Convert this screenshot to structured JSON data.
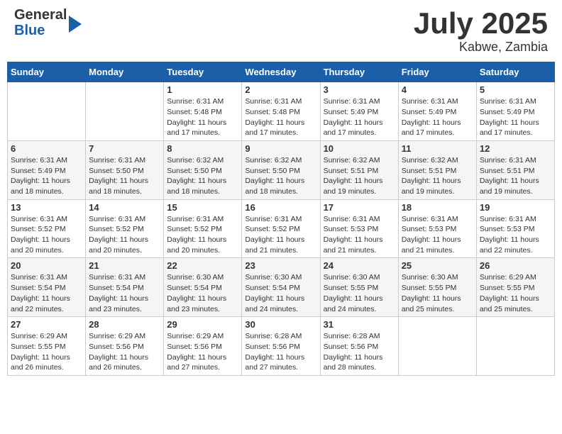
{
  "header": {
    "logo_general": "General",
    "logo_blue": "Blue",
    "month_title": "July 2025",
    "location": "Kabwe, Zambia"
  },
  "calendar": {
    "days_of_week": [
      "Sunday",
      "Monday",
      "Tuesday",
      "Wednesday",
      "Thursday",
      "Friday",
      "Saturday"
    ],
    "weeks": [
      [
        {
          "day": "",
          "info": ""
        },
        {
          "day": "",
          "info": ""
        },
        {
          "day": "1",
          "info": "Sunrise: 6:31 AM\nSunset: 5:48 PM\nDaylight: 11 hours and 17 minutes."
        },
        {
          "day": "2",
          "info": "Sunrise: 6:31 AM\nSunset: 5:48 PM\nDaylight: 11 hours and 17 minutes."
        },
        {
          "day": "3",
          "info": "Sunrise: 6:31 AM\nSunset: 5:49 PM\nDaylight: 11 hours and 17 minutes."
        },
        {
          "day": "4",
          "info": "Sunrise: 6:31 AM\nSunset: 5:49 PM\nDaylight: 11 hours and 17 minutes."
        },
        {
          "day": "5",
          "info": "Sunrise: 6:31 AM\nSunset: 5:49 PM\nDaylight: 11 hours and 17 minutes."
        }
      ],
      [
        {
          "day": "6",
          "info": "Sunrise: 6:31 AM\nSunset: 5:49 PM\nDaylight: 11 hours and 18 minutes."
        },
        {
          "day": "7",
          "info": "Sunrise: 6:31 AM\nSunset: 5:50 PM\nDaylight: 11 hours and 18 minutes."
        },
        {
          "day": "8",
          "info": "Sunrise: 6:32 AM\nSunset: 5:50 PM\nDaylight: 11 hours and 18 minutes."
        },
        {
          "day": "9",
          "info": "Sunrise: 6:32 AM\nSunset: 5:50 PM\nDaylight: 11 hours and 18 minutes."
        },
        {
          "day": "10",
          "info": "Sunrise: 6:32 AM\nSunset: 5:51 PM\nDaylight: 11 hours and 19 minutes."
        },
        {
          "day": "11",
          "info": "Sunrise: 6:32 AM\nSunset: 5:51 PM\nDaylight: 11 hours and 19 minutes."
        },
        {
          "day": "12",
          "info": "Sunrise: 6:31 AM\nSunset: 5:51 PM\nDaylight: 11 hours and 19 minutes."
        }
      ],
      [
        {
          "day": "13",
          "info": "Sunrise: 6:31 AM\nSunset: 5:52 PM\nDaylight: 11 hours and 20 minutes."
        },
        {
          "day": "14",
          "info": "Sunrise: 6:31 AM\nSunset: 5:52 PM\nDaylight: 11 hours and 20 minutes."
        },
        {
          "day": "15",
          "info": "Sunrise: 6:31 AM\nSunset: 5:52 PM\nDaylight: 11 hours and 20 minutes."
        },
        {
          "day": "16",
          "info": "Sunrise: 6:31 AM\nSunset: 5:52 PM\nDaylight: 11 hours and 21 minutes."
        },
        {
          "day": "17",
          "info": "Sunrise: 6:31 AM\nSunset: 5:53 PM\nDaylight: 11 hours and 21 minutes."
        },
        {
          "day": "18",
          "info": "Sunrise: 6:31 AM\nSunset: 5:53 PM\nDaylight: 11 hours and 21 minutes."
        },
        {
          "day": "19",
          "info": "Sunrise: 6:31 AM\nSunset: 5:53 PM\nDaylight: 11 hours and 22 minutes."
        }
      ],
      [
        {
          "day": "20",
          "info": "Sunrise: 6:31 AM\nSunset: 5:54 PM\nDaylight: 11 hours and 22 minutes."
        },
        {
          "day": "21",
          "info": "Sunrise: 6:31 AM\nSunset: 5:54 PM\nDaylight: 11 hours and 23 minutes."
        },
        {
          "day": "22",
          "info": "Sunrise: 6:30 AM\nSunset: 5:54 PM\nDaylight: 11 hours and 23 minutes."
        },
        {
          "day": "23",
          "info": "Sunrise: 6:30 AM\nSunset: 5:54 PM\nDaylight: 11 hours and 24 minutes."
        },
        {
          "day": "24",
          "info": "Sunrise: 6:30 AM\nSunset: 5:55 PM\nDaylight: 11 hours and 24 minutes."
        },
        {
          "day": "25",
          "info": "Sunrise: 6:30 AM\nSunset: 5:55 PM\nDaylight: 11 hours and 25 minutes."
        },
        {
          "day": "26",
          "info": "Sunrise: 6:29 AM\nSunset: 5:55 PM\nDaylight: 11 hours and 25 minutes."
        }
      ],
      [
        {
          "day": "27",
          "info": "Sunrise: 6:29 AM\nSunset: 5:55 PM\nDaylight: 11 hours and 26 minutes."
        },
        {
          "day": "28",
          "info": "Sunrise: 6:29 AM\nSunset: 5:56 PM\nDaylight: 11 hours and 26 minutes."
        },
        {
          "day": "29",
          "info": "Sunrise: 6:29 AM\nSunset: 5:56 PM\nDaylight: 11 hours and 27 minutes."
        },
        {
          "day": "30",
          "info": "Sunrise: 6:28 AM\nSunset: 5:56 PM\nDaylight: 11 hours and 27 minutes."
        },
        {
          "day": "31",
          "info": "Sunrise: 6:28 AM\nSunset: 5:56 PM\nDaylight: 11 hours and 28 minutes."
        },
        {
          "day": "",
          "info": ""
        },
        {
          "day": "",
          "info": ""
        }
      ]
    ]
  }
}
